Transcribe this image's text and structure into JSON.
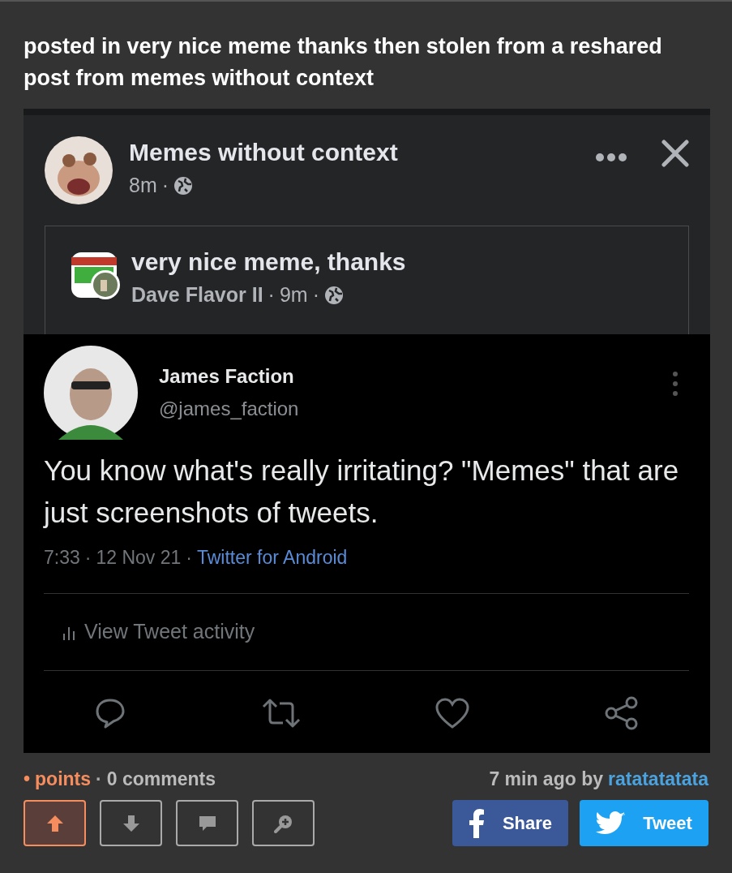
{
  "post_title": "posted in very nice meme thanks then stolen from a reshared post from memes without context",
  "fb_post": {
    "author": "Memes without context",
    "time": "8m",
    "separator": "·",
    "shared": {
      "title": "very nice meme, thanks",
      "author": "Dave Flavor II",
      "time": "9m"
    }
  },
  "tweet": {
    "name": "James Faction",
    "handle": "@james_faction",
    "text": "You know what's really irritating? \"Memes\" that are just screenshots of tweets.",
    "time": "7:33",
    "date": "12 Nov 21",
    "source": "Twitter for Android",
    "activity": "View Tweet activity"
  },
  "footer": {
    "bullet": "•",
    "points": "points",
    "separator": "·",
    "comments": "0 comments",
    "age": "7 min ago by",
    "user": "ratatatatata"
  },
  "vote_buttons": [
    {
      "kind": "up",
      "selected": true
    },
    {
      "kind": "down",
      "selected": false
    },
    {
      "kind": "comment",
      "selected": false
    },
    {
      "kind": "zoom",
      "selected": false
    }
  ],
  "share_buttons": [
    {
      "kind": "facebook",
      "label": "Share"
    },
    {
      "kind": "twitter",
      "label": "Tweet"
    }
  ]
}
